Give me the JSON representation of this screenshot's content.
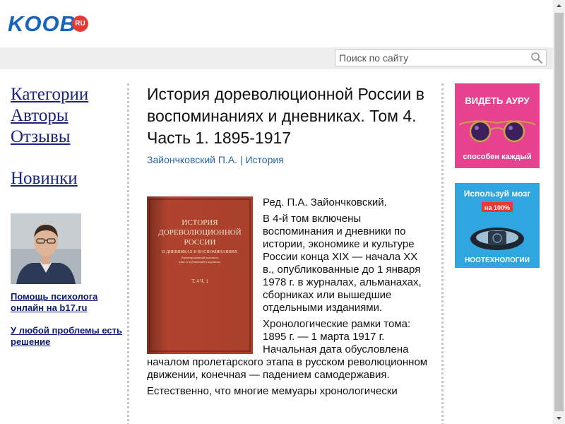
{
  "header": {
    "logo_text": "KOOB",
    "logo_badge": "RU",
    "search_placeholder": "Поиск по сайту"
  },
  "left_nav": {
    "items": [
      "Категории",
      "Авторы",
      "Отзывы"
    ],
    "new_label": "Новинки",
    "promo_links": [
      "Помощь психолога онлайн на b17.ru",
      "У любой проблемы есть решение"
    ]
  },
  "book": {
    "title": "История дореволюционной России в воспоминаниях и дневниках. Том 4. Часть 1. 1895-1917",
    "author": "Зайончковский П.А.",
    "separator": "|",
    "category": "История",
    "cover": {
      "lines": [
        "ИСТОРИЯ",
        "ДОРЕВОЛЮЦИОННОЙ",
        "РОССИИ",
        "В ДНЕВНИКАХ И ВОСПОМИНАНИЯХ"
      ],
      "small_lines": [
        "Аннотированный указатель",
        "книг и публикаций в журналах"
      ],
      "volume": "Т. 4 Ч. 1"
    },
    "paragraphs": [
      "Ред. П.А. Зайончковский.",
      "В 4-й том включены воспоминания и дневники по истории, экономике и культуре России конца XIX — начала XX в., опубликованные до 1 января 1978 г. в журналах, альманахах, сборниках или вышедшие отдельными изданиями.",
      "Хронологические рамки тома: 1895 г. — 1 марта 1917 г. Начальная дата обусловлена началом пролетарского этапа в русском революционном движении, конечная — падением самодержавия.",
      "Естественно, что многие мемуары хронологически"
    ]
  },
  "ads": [
    {
      "top": "ВИДЕТЬ АУРУ",
      "bottom": "способен каждый",
      "bg": "#e8418f"
    },
    {
      "top": "Используй мозг",
      "badge": "на 100%",
      "bottom": "НООТЕХНОЛОГИИ",
      "bg": "#2fa6e0"
    }
  ],
  "colors": {
    "logo": "#1565c0",
    "badge": "#e53935",
    "nav_link": "#1a237e",
    "meta_link": "#2a66a6"
  }
}
